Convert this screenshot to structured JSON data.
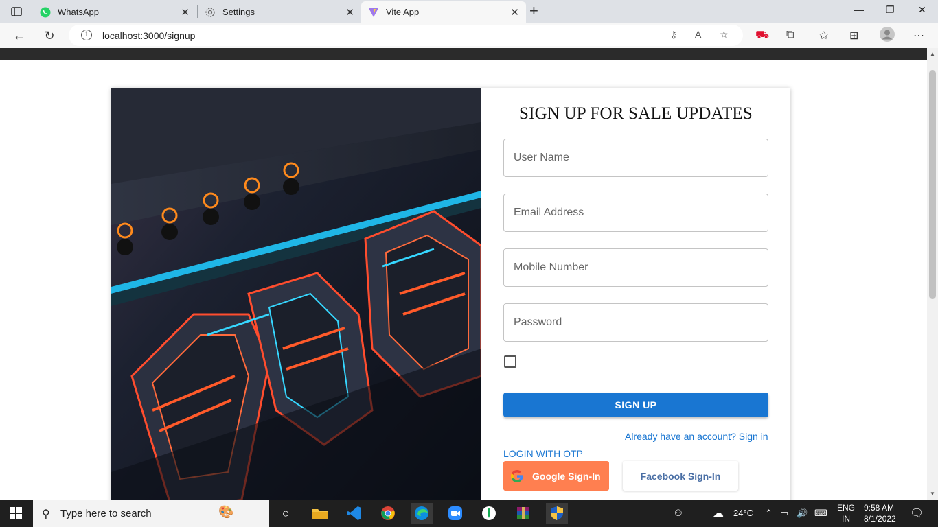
{
  "browser": {
    "tabs": [
      {
        "title": "WhatsApp",
        "icon": "whatsapp-icon",
        "active": false
      },
      {
        "title": "Settings",
        "icon": "gear-icon",
        "active": false
      },
      {
        "title": "Vite App",
        "icon": "vite-icon",
        "active": true
      }
    ],
    "url": "localhost:3000/signup"
  },
  "form": {
    "title": "SIGN UP FOR SALE UPDATES",
    "fields": {
      "username": {
        "placeholder": "User Name",
        "value": ""
      },
      "email": {
        "placeholder": "Email Address",
        "value": ""
      },
      "mobile": {
        "placeholder": "Mobile Number",
        "value": ""
      },
      "password": {
        "placeholder": "Password",
        "value": ""
      }
    },
    "checkbox_checked": false,
    "signup_label": "SIGN UP",
    "signin_link": "Already have an account? Sign in",
    "otp_link": "LOGIN WITH OTP",
    "google_label": "Google Sign-In",
    "facebook_label": "Facebook Sign-In"
  },
  "taskbar": {
    "search_placeholder": "Type here to search",
    "weather": "24°C",
    "lang_top": "ENG",
    "lang_bottom": "IN",
    "time": "9:58 AM",
    "date": "8/1/2022"
  },
  "colors": {
    "primary": "#1976d2",
    "google_button": "#ff7f50",
    "facebook_text": "#4a6fa5"
  }
}
